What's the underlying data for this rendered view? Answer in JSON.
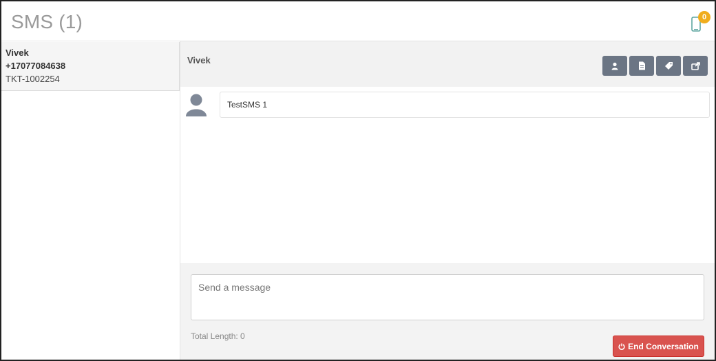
{
  "header": {
    "title": "SMS (1)",
    "notification_count": "0",
    "phone_icon": "mobile-phone-icon",
    "badge_color": "#f0ad1e"
  },
  "sidebar": {
    "conversations": [
      {
        "name": "Vivek",
        "phone": "+17077084638",
        "ticket": "TKT-1002254"
      }
    ]
  },
  "chat": {
    "contact_name": "Vivek",
    "toolbar": [
      {
        "icon": "user-icon"
      },
      {
        "icon": "document-icon"
      },
      {
        "icon": "tag-icon"
      },
      {
        "icon": "share-icon"
      }
    ],
    "messages": [
      {
        "sender_icon": "user-avatar-icon",
        "text": "TestSMS 1"
      }
    ]
  },
  "composer": {
    "placeholder": "Send a message",
    "value": "",
    "total_length_label": "Total Length: 0",
    "end_button_label": "End Conversation",
    "end_button_icon": "power-icon",
    "end_button_color": "#d9534f"
  },
  "colors": {
    "toolbar_button": "#6b7584",
    "panel_background": "#f2f2f2"
  }
}
